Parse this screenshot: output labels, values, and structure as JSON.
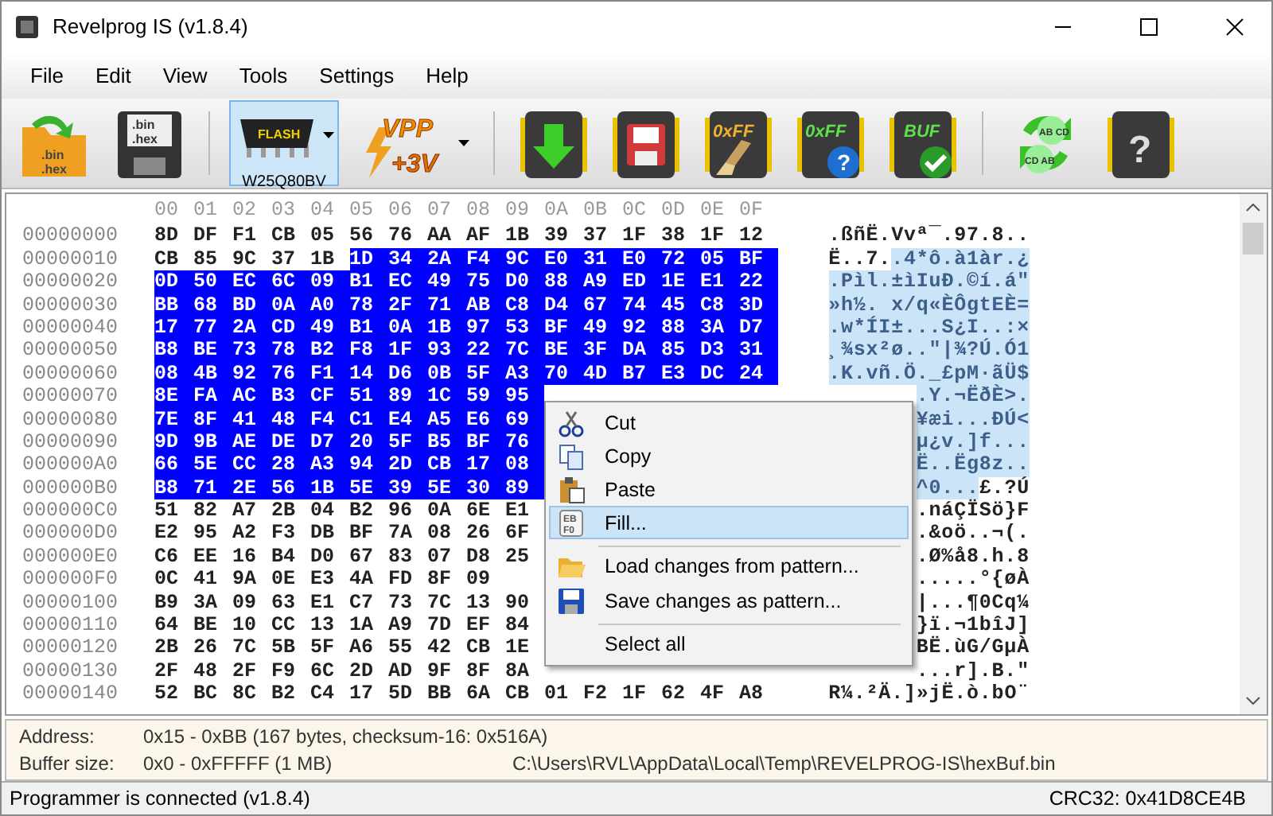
{
  "window": {
    "title": "Revelprog IS (v1.8.4)"
  },
  "menu_bar": [
    "File",
    "Edit",
    "View",
    "Tools",
    "Settings",
    "Help"
  ],
  "toolbar": [
    {
      "texts": [
        ".bin",
        ".hex"
      ],
      "selected": false,
      "dropdown": false,
      "separator_before": false
    },
    {
      "texts": [
        ".bin",
        ".hex"
      ],
      "selected": false,
      "dropdown": false,
      "separator_before": false
    },
    {
      "texts": [
        "FLASH"
      ],
      "label": "W25Q80BV",
      "selected": true,
      "dropdown": true,
      "separator_before": true
    },
    {
      "texts": [
        "VPP",
        "+3V"
      ],
      "selected": false,
      "dropdown": true,
      "separator_before": false
    },
    {
      "selected": false,
      "dropdown": false,
      "separator_before": true
    },
    {
      "selected": false,
      "dropdown": false,
      "separator_before": false
    },
    {
      "texts": [
        "0xFF"
      ],
      "selected": false,
      "dropdown": false,
      "separator_before": false
    },
    {
      "texts": [
        "0xFF",
        "?"
      ],
      "selected": false,
      "dropdown": false,
      "separator_before": false
    },
    {
      "texts": [
        "BUF"
      ],
      "selected": false,
      "dropdown": false,
      "separator_before": false
    },
    {
      "texts": [
        "AB CD",
        "CD AB"
      ],
      "selected": false,
      "dropdown": false,
      "separator_before": true
    },
    {
      "texts": [
        "?"
      ],
      "selected": false,
      "dropdown": false,
      "separator_before": false
    }
  ],
  "hex": {
    "columns": [
      "00",
      "01",
      "02",
      "03",
      "04",
      "05",
      "06",
      "07",
      "08",
      "09",
      "0A",
      "0B",
      "0C",
      "0D",
      "0E",
      "0F"
    ],
    "rows": [
      {
        "address": "00000000",
        "segments": [
          {
            "bytes": [
              "8D",
              "DF",
              "F1",
              "CB",
              "05",
              "56",
              "76",
              "AA",
              "AF",
              "1B",
              "39",
              "37",
              "1F",
              "38",
              "1F",
              "12"
            ],
            "selected": false
          }
        ],
        "ascii": [
          {
            "text": ".ßñË.Vvª¯.97.8..",
            "selected": false
          }
        ]
      },
      {
        "address": "00000010",
        "segments": [
          {
            "bytes": [
              "CB",
              "85",
              "9C",
              "37",
              "1B"
            ],
            "selected": false
          },
          {
            "bytes": [
              "1D",
              "34",
              "2A",
              "F4",
              "9C",
              "E0",
              "31",
              "E0",
              "72",
              "05",
              "BF"
            ],
            "selected": true
          }
        ],
        "ascii": [
          {
            "text": "Ë..7.",
            "selected": false
          },
          {
            "text": ".4*ô.à1àr.¿",
            "selected": true
          }
        ]
      },
      {
        "address": "00000020",
        "segments": [
          {
            "bytes": [
              "0D",
              "50",
              "EC",
              "6C",
              "09",
              "B1",
              "EC",
              "49",
              "75",
              "D0",
              "88",
              "A9",
              "ED",
              "1E",
              "E1",
              "22"
            ],
            "selected": true
          }
        ],
        "ascii": [
          {
            "text": ".Pìl.±ìIuÐ.©í.á\"",
            "selected": true
          }
        ]
      },
      {
        "address": "00000030",
        "segments": [
          {
            "bytes": [
              "BB",
              "68",
              "BD",
              "0A",
              "A0",
              "78",
              "2F",
              "71",
              "AB",
              "C8",
              "D4",
              "67",
              "74",
              "45",
              "C8",
              "3D"
            ],
            "selected": true
          }
        ],
        "ascii": [
          {
            "text": "»h½. x/q«ÈÔgtEÈ=",
            "selected": true
          }
        ]
      },
      {
        "address": "00000040",
        "segments": [
          {
            "bytes": [
              "17",
              "77",
              "2A",
              "CD",
              "49",
              "B1",
              "0A",
              "1B",
              "97",
              "53",
              "BF",
              "49",
              "92",
              "88",
              "3A",
              "D7"
            ],
            "selected": true
          }
        ],
        "ascii": [
          {
            "text": ".w*ÍI±...S¿I..:×",
            "selected": true
          }
        ]
      },
      {
        "address": "00000050",
        "segments": [
          {
            "bytes": [
              "B8",
              "BE",
              "73",
              "78",
              "B2",
              "F8",
              "1F",
              "93",
              "22",
              "7C",
              "BE",
              "3F",
              "DA",
              "85",
              "D3",
              "31"
            ],
            "selected": true
          }
        ],
        "ascii": [
          {
            "text": "¸¾sx²ø..\"|¾?Ú.Ó1",
            "selected": true
          }
        ]
      },
      {
        "address": "00000060",
        "segments": [
          {
            "bytes": [
              "08",
              "4B",
              "92",
              "76",
              "F1",
              "14",
              "D6",
              "0B",
              "5F",
              "A3",
              "70",
              "4D",
              "B7",
              "E3",
              "DC",
              "24"
            ],
            "selected": true
          }
        ],
        "ascii": [
          {
            "text": ".K.vñ.Ö._£pM·ãÜ$",
            "selected": true
          }
        ]
      },
      {
        "address": "00000070",
        "segments": [
          {
            "bytes": [
              "8E",
              "FA",
              "AC",
              "B3",
              "CF",
              "51",
              "89",
              "1C",
              "59",
              "95"
            ],
            "selected": true
          }
        ],
        "ascii": [
          {
            "text": ".Y.¬ËðÈ>.",
            "selected": true
          }
        ]
      },
      {
        "address": "00000080",
        "segments": [
          {
            "bytes": [
              "7E",
              "8F",
              "41",
              "48",
              "F4",
              "C1",
              "E4",
              "A5",
              "E6",
              "69"
            ],
            "selected": true
          }
        ],
        "ascii": [
          {
            "text": "¥æi...ÐÚ<",
            "selected": true
          }
        ]
      },
      {
        "address": "00000090",
        "segments": [
          {
            "bytes": [
              "9D",
              "9B",
              "AE",
              "DE",
              "D7",
              "20",
              "5F",
              "B5",
              "BF",
              "76"
            ],
            "selected": true
          }
        ],
        "ascii": [
          {
            "text": "µ¿v.]f...",
            "selected": true
          }
        ]
      },
      {
        "address": "000000A0",
        "segments": [
          {
            "bytes": [
              "66",
              "5E",
              "CC",
              "28",
              "A3",
              "94",
              "2D",
              "CB",
              "17",
              "08"
            ],
            "selected": true
          }
        ],
        "ascii": [
          {
            "text": "Ë..Ëg8z..",
            "selected": true
          }
        ]
      },
      {
        "address": "000000B0",
        "segments": [
          {
            "bytes": [
              "B8",
              "71",
              "2E",
              "56",
              "1B",
              "5E",
              "39",
              "5E",
              "30",
              "89"
            ],
            "selected": true
          }
        ],
        "ascii": [
          {
            "text": "^0...",
            "selected": true
          },
          {
            "text": "£.?Ú",
            "selected": false
          }
        ]
      },
      {
        "address": "000000C0",
        "segments": [
          {
            "bytes": [
              "51",
              "82",
              "A7",
              "2B",
              "04",
              "B2",
              "96",
              "0A",
              "6E",
              "E1"
            ],
            "selected": false
          }
        ],
        "ascii": [
          {
            "text": ".náÇÏSö}F",
            "selected": false
          }
        ]
      },
      {
        "address": "000000D0",
        "segments": [
          {
            "bytes": [
              "E2",
              "95",
              "A2",
              "F3",
              "DB",
              "BF",
              "7A",
              "08",
              "26",
              "6F"
            ],
            "selected": false
          }
        ],
        "ascii": [
          {
            "text": ".&oö..¬(.",
            "selected": false
          }
        ]
      },
      {
        "address": "000000E0",
        "segments": [
          {
            "bytes": [
              "C6",
              "EE",
              "16",
              "B4",
              "D0",
              "67",
              "83",
              "07",
              "D8",
              "25"
            ],
            "selected": false
          }
        ],
        "ascii": [
          {
            "text": ".Ø%å8.h.8",
            "selected": false
          }
        ]
      },
      {
        "address": "000000F0",
        "segments": [
          {
            "bytes": [
              "0C",
              "41",
              "9A",
              "0E",
              "E3",
              "4A",
              "FD",
              "8F",
              "09"
            ],
            "selected": false
          }
        ],
        "ascii": [
          {
            "text": ".....°{øÀ",
            "selected": false
          }
        ]
      },
      {
        "address": "00000100",
        "segments": [
          {
            "bytes": [
              "B9",
              "3A",
              "09",
              "63",
              "E1",
              "C7",
              "73",
              "7C",
              "13",
              "90"
            ],
            "selected": false
          }
        ],
        "ascii": [
          {
            "text": "|...¶0Cq¼",
            "selected": false
          }
        ]
      },
      {
        "address": "00000110",
        "segments": [
          {
            "bytes": [
              "64",
              "BE",
              "10",
              "CC",
              "13",
              "1A",
              "A9",
              "7D",
              "EF",
              "84"
            ],
            "selected": false
          }
        ],
        "ascii": [
          {
            "text": "}ï.¬1bîJ]",
            "selected": false
          }
        ]
      },
      {
        "address": "00000120",
        "segments": [
          {
            "bytes": [
              "2B",
              "26",
              "7C",
              "5B",
              "5F",
              "A6",
              "55",
              "42",
              "CB",
              "1E"
            ],
            "selected": false
          }
        ],
        "ascii": [
          {
            "text": "BË.ùG/GµÀ",
            "selected": false
          }
        ]
      },
      {
        "address": "00000130",
        "segments": [
          {
            "bytes": [
              "2F",
              "48",
              "2F",
              "F9",
              "6C",
              "2D",
              "AD",
              "9F",
              "8F",
              "8A"
            ],
            "selected": false
          }
        ],
        "ascii": [
          {
            "text": "...r].B.\"",
            "selected": false
          }
        ]
      },
      {
        "address": "00000140",
        "segments": [
          {
            "bytes": [
              "52",
              "BC",
              "8C",
              "B2",
              "C4",
              "17",
              "5D",
              "BB",
              "6A",
              "CB",
              "01",
              "F2",
              "1F",
              "62",
              "4F",
              "A8"
            ],
            "selected": false
          }
        ],
        "ascii": [
          {
            "text": "R¼.²Ä.]»jË.ò.bO¨",
            "selected": false
          }
        ]
      }
    ]
  },
  "context_menu": {
    "items": [
      {
        "label": "Cut",
        "selected": false,
        "separator_before": false
      },
      {
        "label": "Copy",
        "selected": false,
        "separator_before": false
      },
      {
        "label": "Paste",
        "selected": false,
        "separator_before": false
      },
      {
        "label": "Fill...",
        "icon_text": [
          "EB",
          "F0"
        ],
        "selected": true,
        "separator_before": false
      },
      {
        "label": "Load changes from pattern...",
        "selected": false,
        "separator_before": true
      },
      {
        "label": "Save changes as pattern...",
        "selected": false,
        "separator_before": false
      },
      {
        "label": "Select all",
        "selected": false,
        "separator_before": true
      }
    ]
  },
  "info": {
    "address_label": "Address:",
    "address_value": "0x15 - 0xBB (167 bytes, checksum-16: 0x516A)",
    "buffer_label": "Buffer size:",
    "buffer_value": "0x0 - 0xFFFFF (1 MB)",
    "file_path": "C:\\Users\\RVL\\AppData\\Local\\Temp\\REVELPROG-IS\\hexBuf.bin"
  },
  "status_bar": {
    "message": "Programmer is connected (v1.8.4)",
    "crc": "CRC32: 0x41D8CE4B"
  }
}
